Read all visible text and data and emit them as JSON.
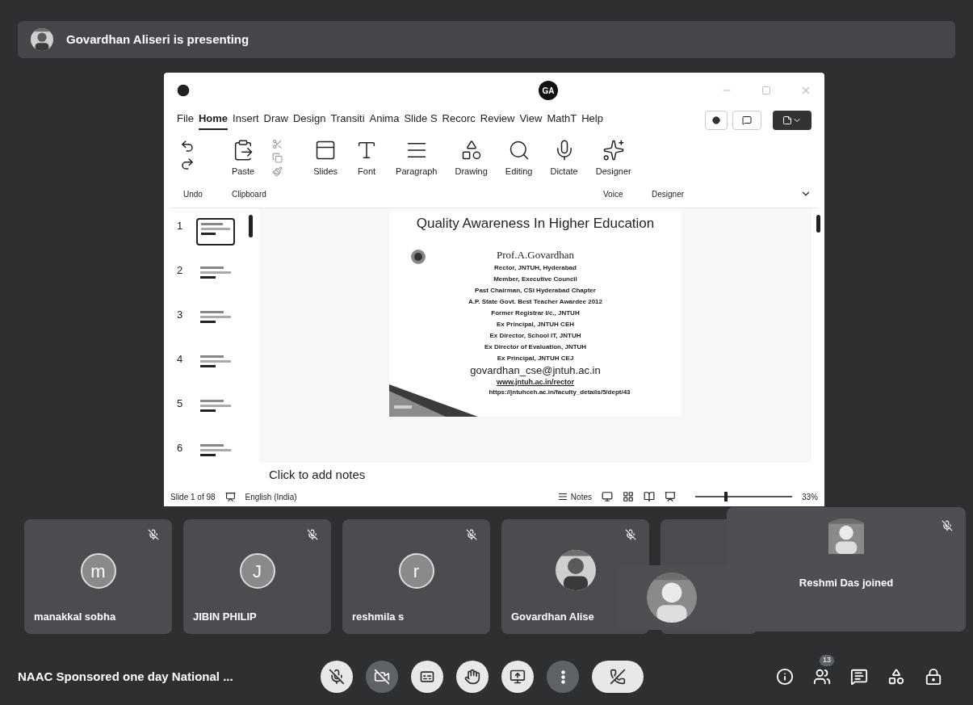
{
  "banner": {
    "text": "Govardhan Aliseri is presenting"
  },
  "app_window": {
    "account_initials": "GA",
    "tabs": [
      {
        "label": "File",
        "selected": false
      },
      {
        "label": "Home",
        "selected": true
      },
      {
        "label": "Insert",
        "selected": false
      },
      {
        "label": "Draw",
        "selected": false
      },
      {
        "label": "Design",
        "selected": false
      },
      {
        "label": "Transiti",
        "selected": false
      },
      {
        "label": "Anima",
        "selected": false
      },
      {
        "label": "Slide S",
        "selected": false
      },
      {
        "label": "Recorc",
        "selected": false
      },
      {
        "label": "Review",
        "selected": false
      },
      {
        "label": "View",
        "selected": false
      },
      {
        "label": "MathT",
        "selected": false
      },
      {
        "label": "Help",
        "selected": false
      }
    ],
    "ribbon_commands": [
      {
        "label": "Paste",
        "kind": "paste"
      },
      {
        "label": "Slides",
        "kind": "slides"
      },
      {
        "label": "Font",
        "kind": "font"
      },
      {
        "label": "Paragraph",
        "kind": "paragraph"
      },
      {
        "label": "Drawing",
        "kind": "drawing"
      },
      {
        "label": "Editing",
        "kind": "editing"
      },
      {
        "label": "Dictate",
        "kind": "dictate"
      },
      {
        "label": "Designer",
        "kind": "designer"
      }
    ],
    "group_labels": [
      "Undo",
      "Clipboard",
      "Voice",
      "Designer"
    ],
    "thumbnails": [
      {
        "number": "1",
        "selected": true
      },
      {
        "number": "2",
        "selected": false
      },
      {
        "number": "3",
        "selected": false
      },
      {
        "number": "4",
        "selected": false
      },
      {
        "number": "5",
        "selected": false
      },
      {
        "number": "6",
        "selected": false
      }
    ],
    "slide": {
      "title": "Quality Awareness In Higher Education",
      "name": "Prof.A.Govardhan",
      "lines": [
        "Rector, JNTUH, Hyderabad",
        "Member, Executive Council",
        "Past Chairman, CSI Hyderabad Chapter",
        "A.P. State Govt. Best Teacher Awardee 2012",
        "Former Registrar I/c., JNTUH",
        "Ex Principal, JNTUH CEH",
        "Ex Director, School IT, JNTUH",
        "Ex Director of Evaluation, JNTUH",
        "Ex Principal, JNTUH CEJ"
      ],
      "email": "govardhan_cse@jntuh.ac.in",
      "link": "www.jntuh.ac.in/rector",
      "url": "https://jntuhceh.ac.in/faculty_details/5/dept/43"
    },
    "notes_placeholder": "Click to add notes",
    "status_bar": {
      "slide_counter": "Slide 1 of 98",
      "language": "English (India)",
      "notes": "Notes",
      "zoom": "33%",
      "zoom_slider": {
        "level": 0.3
      }
    }
  },
  "participants": [
    {
      "name": "manakkal sobha",
      "initial": "m",
      "kind": "initial",
      "muted": true
    },
    {
      "name": "JIBIN PHILIP",
      "initial": "J",
      "kind": "initial",
      "muted": true
    },
    {
      "name": "reshmila s",
      "initial": "r",
      "kind": "initial",
      "muted": true
    },
    {
      "name": "Govardhan Alise",
      "muted": true
    },
    {
      "kind": "partial"
    }
  ],
  "notification": {
    "text": "Reshmi Das joined",
    "muted": true
  },
  "meeting_title": "NAAC Sponsored one day National ...",
  "controls": [
    {
      "kind": "mic",
      "on": false
    },
    {
      "kind": "camera",
      "on": false
    },
    {
      "kind": "captions"
    },
    {
      "kind": "hand"
    },
    {
      "kind": "present"
    },
    {
      "kind": "more"
    },
    {
      "kind": "leave"
    }
  ],
  "side_controls": [
    {
      "kind": "info"
    },
    {
      "kind": "people",
      "badge": "13"
    },
    {
      "kind": "chat"
    },
    {
      "kind": "activities"
    },
    {
      "kind": "host"
    }
  ]
}
